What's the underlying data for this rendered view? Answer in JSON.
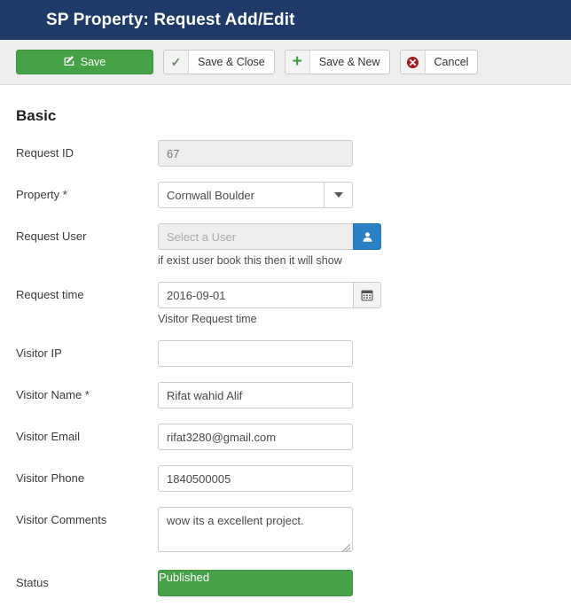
{
  "header": {
    "title": "SP Property: Request Add/Edit",
    "bg_color": "#1d3a68"
  },
  "toolbar": {
    "save_label": "Save",
    "save_icon": "edit-pencil-square-icon",
    "save_close_label": "Save & Close",
    "save_close_icon": "checkmark-icon",
    "save_new_label": "Save & New",
    "save_new_icon": "plus-icon",
    "cancel_label": "Cancel",
    "cancel_icon": "circle-x-icon",
    "primary_color": "#45a247",
    "cancel_icon_color": "#a51d22"
  },
  "form": {
    "section_title": "Basic",
    "fields": {
      "request_id": {
        "label": "Request ID",
        "value": "67"
      },
      "property": {
        "label": "Property *",
        "value": "Cornwall Boulder"
      },
      "request_user": {
        "label": "Request User",
        "value": "",
        "placeholder": "Select a User",
        "addon_icon": "user-icon",
        "addon_color": "#2980c4",
        "helper": "if exist user book this then it will show"
      },
      "request_time": {
        "label": "Request time",
        "value": "2016-09-01",
        "addon_icon": "calendar-icon",
        "helper": "Visitor Request time"
      },
      "visitor_ip": {
        "label": "Visitor IP",
        "value": ""
      },
      "visitor_name": {
        "label": "Visitor Name *",
        "value": "Rifat wahid Alif"
      },
      "visitor_email": {
        "label": "Visitor Email",
        "value": "rifat3280@gmail.com"
      },
      "visitor_phone": {
        "label": "Visitor Phone",
        "value": "1840500005"
      },
      "visitor_comments": {
        "label": "Visitor Comments",
        "value": "wow its a excellent project."
      },
      "status": {
        "label": "Status",
        "value": "Published",
        "color": "#45a247"
      }
    }
  }
}
